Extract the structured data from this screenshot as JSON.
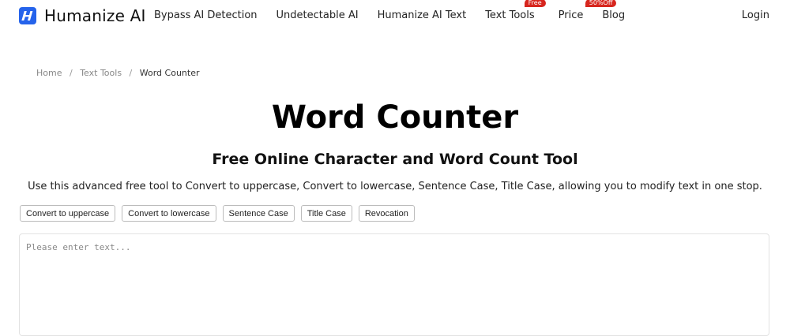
{
  "brand": {
    "name": "Humanize AI",
    "logo_letter": "H",
    "accent": "#2563eb"
  },
  "nav": {
    "items": [
      {
        "label": "Bypass AI Detection",
        "badge": ""
      },
      {
        "label": "Undetectable AI",
        "badge": ""
      },
      {
        "label": "Humanize AI Text",
        "badge": ""
      },
      {
        "label": "Text Tools",
        "badge": "Free"
      },
      {
        "label": "Price",
        "badge": "50%Off"
      },
      {
        "label": "Blog",
        "badge": ""
      }
    ],
    "login": "Login",
    "badge_color": "#d7261e"
  },
  "breadcrumb": {
    "home": "Home",
    "section": "Text Tools",
    "current": "Word Counter",
    "separator": "/"
  },
  "page": {
    "title": "Word Counter",
    "subtitle": "Free Online Character and Word Count Tool",
    "description": "Use this advanced free tool to Convert to uppercase, Convert to lowercase, Sentence Case, Title Case, allowing you to modify text in one stop."
  },
  "tools": {
    "buttons": [
      "Convert to uppercase",
      "Convert to lowercase",
      "Sentence Case",
      "Title Case",
      "Revocation"
    ]
  },
  "editor": {
    "placeholder": "Please enter text...",
    "value": ""
  }
}
